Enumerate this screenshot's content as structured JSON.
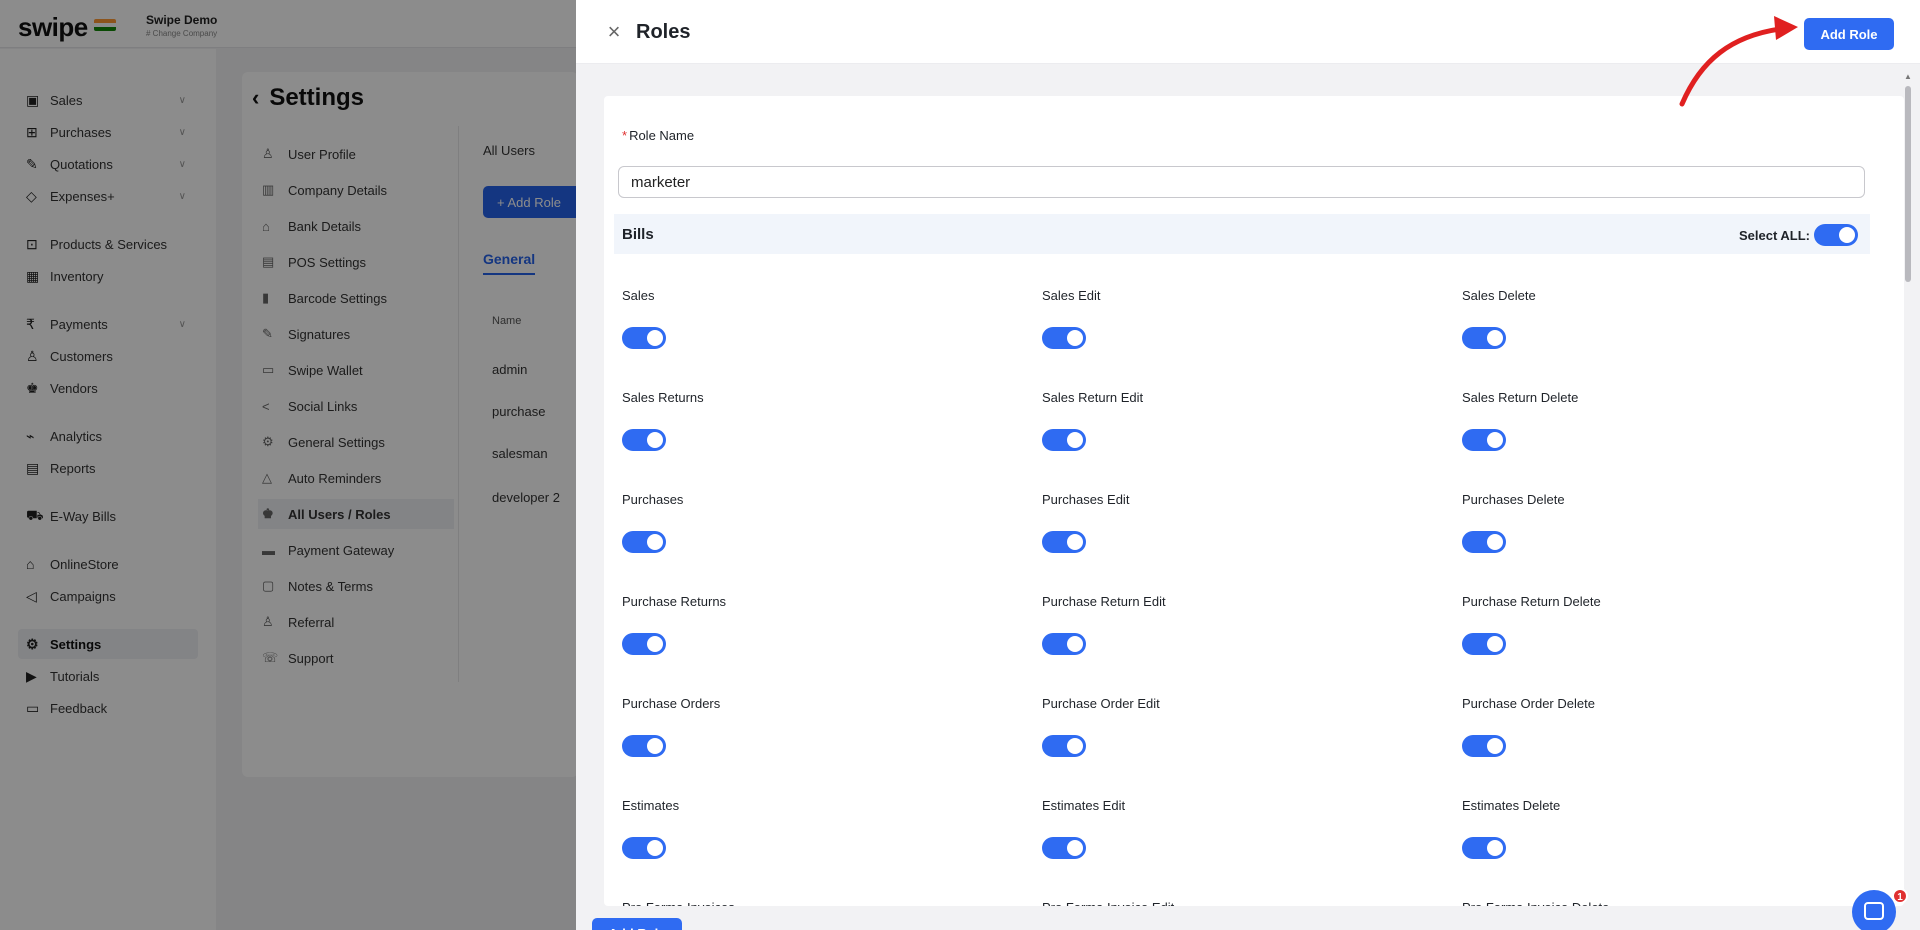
{
  "brand": {
    "logo": "swipe",
    "org_name": "Swipe Demo",
    "org_sub": "# Change Company"
  },
  "sidebar": {
    "items": [
      {
        "label": "Sales",
        "icon": "sales-icon",
        "glyph": "▣"
      },
      {
        "label": "Purchases",
        "icon": "cart-icon",
        "glyph": "⊞"
      },
      {
        "label": "Quotations",
        "icon": "pen-icon",
        "glyph": "✎"
      },
      {
        "label": "Expenses+",
        "icon": "tag-icon",
        "glyph": "◇"
      },
      {
        "label": "Products & Services",
        "icon": "box-icon",
        "glyph": "⊡"
      },
      {
        "label": "Inventory",
        "icon": "warehouse-icon",
        "glyph": "▦"
      },
      {
        "label": "Payments",
        "icon": "rupee-icon",
        "glyph": "₹"
      },
      {
        "label": "Customers",
        "icon": "user-icon",
        "glyph": "♙"
      },
      {
        "label": "Vendors",
        "icon": "users-icon",
        "glyph": "♚"
      },
      {
        "label": "Analytics",
        "icon": "chart-icon",
        "glyph": "⌁"
      },
      {
        "label": "Reports",
        "icon": "report-icon",
        "glyph": "▤"
      },
      {
        "label": "E-Way Bills",
        "icon": "truck-icon",
        "glyph": "⛟"
      },
      {
        "label": "OnlineStore",
        "icon": "store-icon",
        "glyph": "⌂"
      },
      {
        "label": "Campaigns",
        "icon": "megaphone-icon",
        "glyph": "◁"
      },
      {
        "label": "Settings",
        "icon": "gear-icon",
        "glyph": "⚙"
      },
      {
        "label": "Tutorials",
        "icon": "video-icon",
        "glyph": "▶"
      },
      {
        "label": "Feedback",
        "icon": "message-icon",
        "glyph": "▭"
      }
    ]
  },
  "settings": {
    "title": "Settings",
    "items": [
      {
        "label": "User Profile",
        "glyph": "♙"
      },
      {
        "label": "Company Details",
        "glyph": "▥"
      },
      {
        "label": "Bank Details",
        "glyph": "⌂"
      },
      {
        "label": "POS Settings",
        "glyph": "▤"
      },
      {
        "label": "Barcode Settings",
        "glyph": "▮"
      },
      {
        "label": "Signatures",
        "glyph": "✎"
      },
      {
        "label": "Swipe Wallet",
        "glyph": "▭"
      },
      {
        "label": "Social Links",
        "glyph": "<"
      },
      {
        "label": "General Settings",
        "glyph": "⚙"
      },
      {
        "label": "Auto Reminders",
        "glyph": "△"
      },
      {
        "label": "All Users / Roles",
        "glyph": "♚"
      },
      {
        "label": "Payment Gateway",
        "glyph": "▬"
      },
      {
        "label": "Notes & Terms",
        "glyph": "▢"
      },
      {
        "label": "Referral",
        "glyph": "♙"
      },
      {
        "label": "Support",
        "glyph": "☏"
      }
    ],
    "users_heading": "All Users",
    "add_role_button": "+ Add Role",
    "tab": "General",
    "name_column": "Name",
    "users": [
      "admin",
      "purchase",
      "salesman",
      "developer 2"
    ]
  },
  "drawer": {
    "title": "Roles",
    "add_role_button": "Add Role",
    "role_name_label": "Role Name",
    "role_name_value": "marketer",
    "section_title": "Bills",
    "select_all_label": "Select ALL:",
    "select_all_on": true,
    "permissions": [
      {
        "label": "Sales",
        "on": true
      },
      {
        "label": "Sales Edit",
        "on": true
      },
      {
        "label": "Sales Delete",
        "on": true
      },
      {
        "label": "Sales Returns",
        "on": true
      },
      {
        "label": "Sales Return Edit",
        "on": true
      },
      {
        "label": "Sales Return Delete",
        "on": true
      },
      {
        "label": "Purchases",
        "on": true
      },
      {
        "label": "Purchases Edit",
        "on": true
      },
      {
        "label": "Purchases Delete",
        "on": true
      },
      {
        "label": "Purchase Returns",
        "on": true
      },
      {
        "label": "Purchase Return Edit",
        "on": true
      },
      {
        "label": "Purchase Return Delete",
        "on": true
      },
      {
        "label": "Purchase Orders",
        "on": true
      },
      {
        "label": "Purchase Order Edit",
        "on": true
      },
      {
        "label": "Purchase Order Delete",
        "on": true
      },
      {
        "label": "Estimates",
        "on": true
      },
      {
        "label": "Estimates Edit",
        "on": true
      },
      {
        "label": "Estimates Delete",
        "on": true
      },
      {
        "label": "Pro Forma Invoices",
        "on": true
      },
      {
        "label": "Pro Forma Invoice Edit",
        "on": true
      },
      {
        "label": "Pro Forma Invoice Delete",
        "on": true
      }
    ],
    "footer_button": "Add Role"
  },
  "chat": {
    "badge": "1"
  },
  "colors": {
    "primary": "#2f6bf2",
    "arrow": "#e02020",
    "required": "#e03131"
  }
}
